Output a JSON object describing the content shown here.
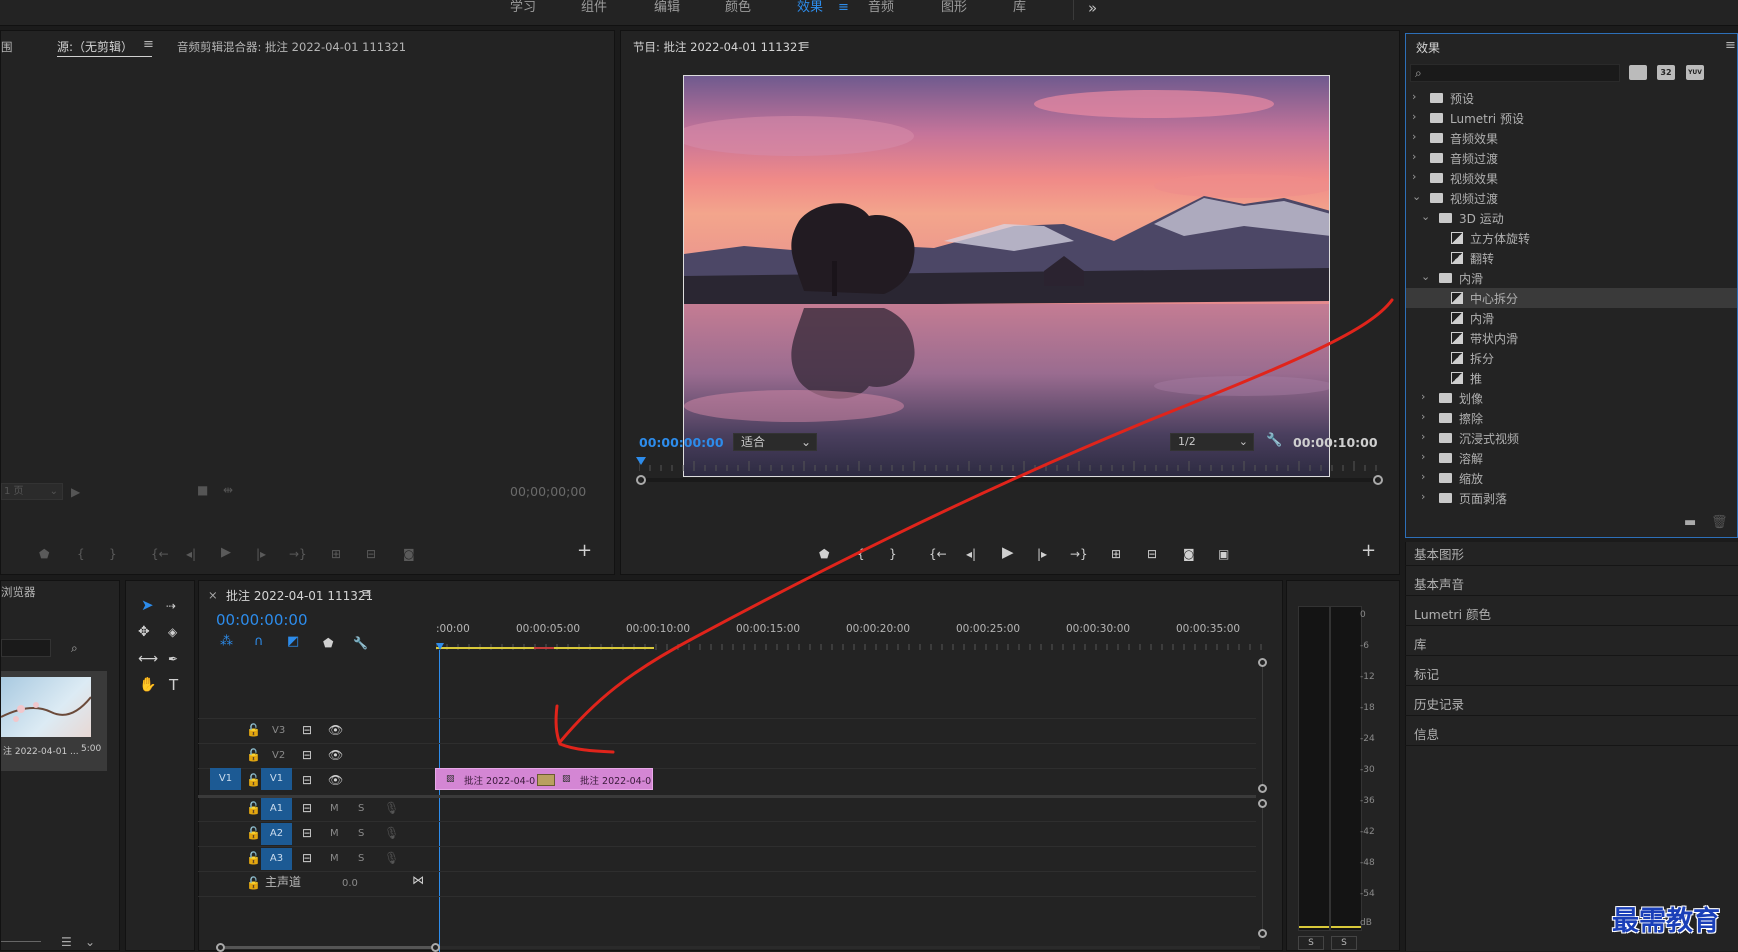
{
  "workspaces": {
    "items": [
      "学习",
      "组件",
      "编辑",
      "颜色",
      "效果",
      "音频",
      "图形",
      "库"
    ],
    "active": "效果",
    "menu_glyph": "≡",
    "overflow_glyph": "»"
  },
  "source_panel": {
    "partial_tab": "围",
    "tab_source": "源:（无剪辑）",
    "tab_source_menu": "≡",
    "tab_mixer": "音频剪辑混合器: 批注 2022-04-01 111321",
    "page_select": "1 页",
    "timecode": "00;00;00;00"
  },
  "program_monitor": {
    "title": "节目: 批注 2022-04-01 111321",
    "menu_glyph": "≡",
    "timecode_current": "00:00:00:00",
    "fit_select": "适合",
    "resolution_select": "1/2",
    "timecode_duration": "00:00:10:00"
  },
  "effects_panel": {
    "title": "效果",
    "menu_glyph": "≡",
    "search_placeholder": "",
    "filter_buttons": [
      "32",
      "YUV"
    ],
    "tree": [
      {
        "label": "预设",
        "type": "folder-special",
        "level": 0,
        "expanded": false
      },
      {
        "label": "Lumetri 预设",
        "type": "folder-special",
        "level": 0,
        "expanded": false
      },
      {
        "label": "音频效果",
        "type": "folder",
        "level": 0,
        "expanded": false
      },
      {
        "label": "音频过渡",
        "type": "folder",
        "level": 0,
        "expanded": false
      },
      {
        "label": "视频效果",
        "type": "folder",
        "level": 0,
        "expanded": false
      },
      {
        "label": "视频过渡",
        "type": "folder",
        "level": 0,
        "expanded": true
      },
      {
        "label": "3D 运动",
        "type": "folder",
        "level": 1,
        "expanded": true
      },
      {
        "label": "立方体旋转",
        "type": "preset",
        "level": 2
      },
      {
        "label": "翻转",
        "type": "preset",
        "level": 2
      },
      {
        "label": "内滑",
        "type": "folder",
        "level": 1,
        "expanded": true
      },
      {
        "label": "中心拆分",
        "type": "preset",
        "level": 2,
        "selected": true
      },
      {
        "label": "内滑",
        "type": "preset",
        "level": 2
      },
      {
        "label": "带状内滑",
        "type": "preset",
        "level": 2
      },
      {
        "label": "拆分",
        "type": "preset",
        "level": 2
      },
      {
        "label": "推",
        "type": "preset",
        "level": 2
      },
      {
        "label": "划像",
        "type": "folder",
        "level": 1,
        "expanded": false
      },
      {
        "label": "擦除",
        "type": "folder",
        "level": 1,
        "expanded": false
      },
      {
        "label": "沉浸式视频",
        "type": "folder",
        "level": 1,
        "expanded": false
      },
      {
        "label": "溶解",
        "type": "folder",
        "level": 1,
        "expanded": false
      },
      {
        "label": "缩放",
        "type": "folder",
        "level": 1,
        "expanded": false
      },
      {
        "label": "页面剥落",
        "type": "folder",
        "level": 1,
        "expanded": false
      }
    ]
  },
  "side_panels": [
    "基本图形",
    "基本声音",
    "Lumetri 颜色",
    "库",
    "标记",
    "历史记录",
    "信息"
  ],
  "project_panel": {
    "partial_title": "浏览器",
    "clip_name": "注 2022-04-01 ...",
    "clip_duration": "5:00"
  },
  "timeline": {
    "close_glyph": "×",
    "sequence_tab": "批注 2022-04-01 111321",
    "menu_glyph": "≡",
    "timecode": "00:00:00:00",
    "ruler": [
      ":00:00",
      "00:00:05:00",
      "00:00:10:00",
      "00:00:15:00",
      "00:00:20:00",
      "00:00:25:00",
      "00:00:30:00",
      "00:00:35:00"
    ],
    "video_tracks": [
      {
        "name": "V3",
        "target": ""
      },
      {
        "name": "V2",
        "target": ""
      },
      {
        "name": "V1",
        "target": "V1"
      }
    ],
    "audio_tracks": [
      {
        "name": "A1",
        "target": "A1",
        "m": "M",
        "s": "S"
      },
      {
        "name": "A2",
        "target": "A2",
        "m": "M",
        "s": "S"
      },
      {
        "name": "A3",
        "target": "A3",
        "m": "M",
        "s": "S"
      }
    ],
    "master": {
      "label": "主声道",
      "value": "0.0"
    },
    "clips": [
      {
        "label": "批注 2022-04-0",
        "color": "#d486d4"
      },
      {
        "label": "批注 2022-04-0",
        "color": "#d486d4"
      }
    ]
  },
  "audio_meter": {
    "scale": [
      "0",
      "-6",
      "-12",
      "-18",
      "-24",
      "-30",
      "-36",
      "-42",
      "-48",
      "-54",
      "dB"
    ],
    "solo_buttons": [
      "S",
      "S"
    ]
  },
  "watermark": "最需教育",
  "colors": {
    "accent_blue": "#2d8ceb",
    "clip_pink": "#d486d4",
    "annotation_red": "#e0241b",
    "watermark_blue": "#1a3fb8"
  }
}
